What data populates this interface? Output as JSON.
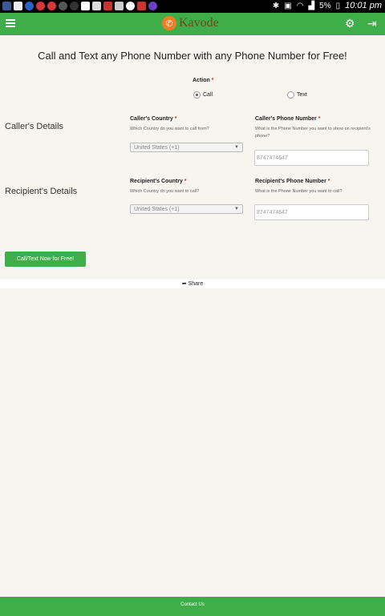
{
  "status_bar": {
    "battery": "5%",
    "time": "10:01 pm"
  },
  "app_bar": {
    "brand": "Kavode"
  },
  "headline": "Call and Text any Phone Number with any Phone Number for Free!",
  "action": {
    "label": "Action",
    "required_mark": "*",
    "options": [
      {
        "label": "Call",
        "checked": true
      },
      {
        "label": "Text",
        "checked": false
      }
    ]
  },
  "callers": {
    "section_title": "Caller's Details",
    "country_label": "Caller's Country",
    "country_hint": "Which Country do you want to call from?",
    "country_value": "United States (+1)",
    "phone_label": "Caller's Phone Number",
    "phone_hint": "What is the Phone Number you want to show on recipient's phone?",
    "phone_placeholder": "8747474647"
  },
  "recipient": {
    "section_title": "Recipient's Details",
    "country_label": "Recipient's Country",
    "country_hint": "Which Country do you want to call?",
    "country_value": "United States (+1)",
    "phone_label": "Recipient's Phone Number",
    "phone_hint": "What is the Phone Number you want to call?",
    "phone_placeholder": "8747474647"
  },
  "submit_label": "Call/Text Now for Free!",
  "share_label": "Share",
  "footer_label": "Contact Us"
}
